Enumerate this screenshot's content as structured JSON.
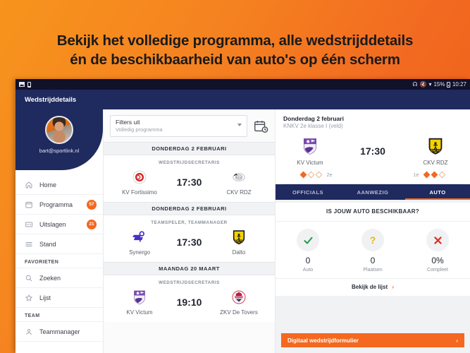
{
  "promo": {
    "line1": "Bekijk het volledige programma, alle wedstrijddetails",
    "line2": "én de beschikbaarheid van auto's op één scherm"
  },
  "colors": {
    "brand_orange": "#f4681f",
    "navy": "#1f2a5e",
    "yellow": "#f5c518",
    "green": "#1e9e4a",
    "amber": "#e8b60c",
    "red": "#d93025"
  },
  "status_bar": {
    "left_icons": [
      "screenshot-icon",
      "document-icon"
    ],
    "right_icons": [
      "bluetooth-icon",
      "mute-icon",
      "wifi-icon"
    ],
    "battery_percent": "15%",
    "clock": "10:27"
  },
  "app_bar": {
    "title": "Wedstrijddetails"
  },
  "sidebar": {
    "email": "bart@sportlink.nl",
    "items": [
      {
        "label": "Home",
        "icon": "home-icon",
        "badge": ""
      },
      {
        "label": "Programma",
        "icon": "calendar-icon",
        "badge": "57"
      },
      {
        "label": "Uitslagen",
        "icon": "scoreboard-icon",
        "badge": "21"
      },
      {
        "label": "Stand",
        "icon": "list-icon",
        "badge": ""
      }
    ],
    "section_favorites": "FAVORIETEN",
    "favorites": [
      {
        "label": "Zoeken",
        "icon": "search-icon",
        "badge": ""
      },
      {
        "label": "Lijst",
        "icon": "star-icon",
        "badge": ""
      }
    ],
    "section_team": "TEAM",
    "team": [
      {
        "label": "Teammanager",
        "icon": "person-icon",
        "badge": ""
      }
    ]
  },
  "program": {
    "filter": {
      "value": "Filters uit",
      "subvalue": "Volledig programma",
      "caret_icon": "chevron-down-icon"
    },
    "calendar_icon": "calendar-clock-icon",
    "groups": [
      {
        "day": "DONDERDAG 2 FEBRUARI",
        "matches": [
          {
            "role": "WEDSTRIJDSECRETARIS",
            "time": "17:30",
            "home": {
              "name": "KV Fortissimo",
              "crest": "fortissimo-crest"
            },
            "away": {
              "name": "CKV RDZ",
              "crest": "rdz-crest"
            }
          }
        ]
      },
      {
        "day": "DONDERDAG 2 FEBRUARI",
        "matches": [
          {
            "role": "TEAMSPELER, TEAMMANAGER",
            "time": "17:30",
            "home": {
              "name": "Synergo",
              "crest": "synergo-crest"
            },
            "away": {
              "name": "Dalto",
              "crest": "dalto-crest"
            }
          }
        ]
      },
      {
        "day": "MAANDAG 20 MAART",
        "matches": [
          {
            "role": "WEDSTRIJDSECRETARIS",
            "time": "19:10",
            "home": {
              "name": "KV Victum",
              "crest": "victum-crest"
            },
            "away": {
              "name": "ZKV De Tovers",
              "crest": "tovers-crest"
            }
          }
        ]
      }
    ]
  },
  "detail": {
    "date": "Donderdag 2 februari",
    "competition": "KNKV 2e klasse I (veld)",
    "time": "17:30",
    "home": {
      "name": "KV Victum",
      "crest": "victum-crest",
      "rank": "2e",
      "form": [
        1,
        0,
        0
      ]
    },
    "away": {
      "name": "CKV RDZ",
      "crest": "dalto-crest",
      "rank": "1e",
      "form": [
        1,
        1,
        0
      ]
    },
    "tabs": [
      {
        "label": "OFFICIALS",
        "active": false
      },
      {
        "label": "AANWEZIG",
        "active": false
      },
      {
        "label": "AUTO",
        "active": true
      }
    ],
    "auto": {
      "question": "IS JOUW AUTO BESCHIKBAAR?",
      "stats": [
        {
          "icon": "check-icon",
          "value": "0",
          "label": "Auto",
          "tone": "ok"
        },
        {
          "icon": "question-icon",
          "value": "0",
          "label": "Plaatsen",
          "tone": "q"
        },
        {
          "icon": "cross-icon",
          "value": "0%",
          "label": "Compleet",
          "tone": "no"
        }
      ],
      "list_link": "Bekijk de lijst",
      "list_link_icon": "chevron-right-icon"
    },
    "cta": {
      "label": "Digitaal wedstrijdformulier",
      "icon": "chevron-right-icon"
    }
  }
}
